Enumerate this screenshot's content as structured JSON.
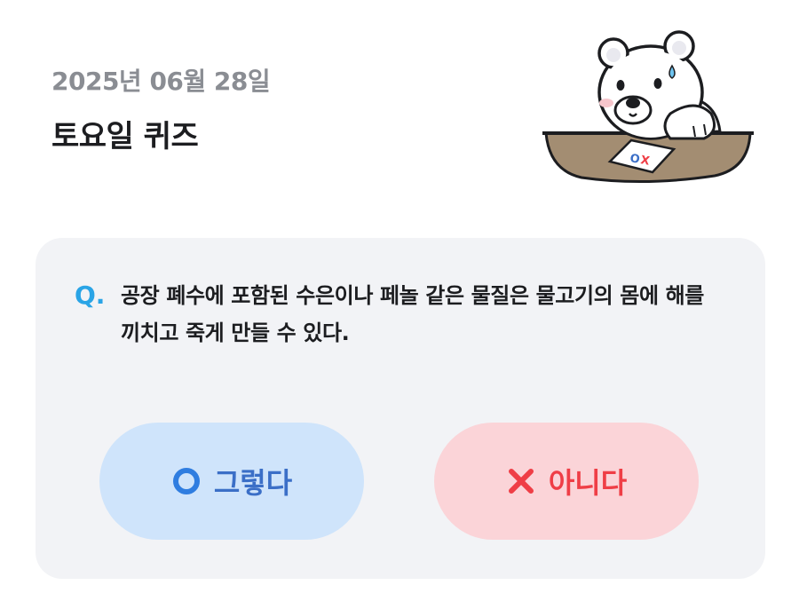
{
  "header": {
    "date": "2025년 06월 28일",
    "title": "토요일 퀴즈"
  },
  "quiz": {
    "question_marker": "Q.",
    "question": "공장 폐수에 포함된 수은이나 페놀 같은 물질은 물고기의 몸에 해를 끼치고 죽게 만들 수 있다.",
    "answers": [
      {
        "label": "그렇다",
        "icon": "circle-o-icon",
        "color": "#3b6fc7"
      },
      {
        "label": "아니다",
        "icon": "x-icon",
        "color": "#ef3e46"
      }
    ]
  },
  "mascot": {
    "icon": "bear-mascot-illustration",
    "paper_text": "OX"
  },
  "colors": {
    "accent_blue": "#2aa4e6",
    "yes_bg": "#cfe4fb",
    "no_bg": "#fbd4d8",
    "card_bg": "#f2f3f6"
  }
}
